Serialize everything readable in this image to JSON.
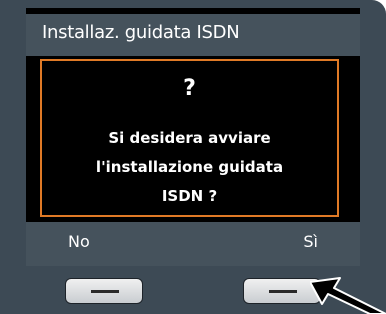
{
  "header": {
    "title": "Installaz. guidata ISDN"
  },
  "dialog": {
    "symbol": "?",
    "lines": [
      "Si desidera avviare",
      "l'installazione guidata",
      "ISDN ?"
    ]
  },
  "softkeys": {
    "left_label": "No",
    "right_label": "Sì"
  },
  "colors": {
    "accent": "#e07a26",
    "bar": "#45525c",
    "body": "#3d4a55"
  },
  "icons": {
    "key_symbol": "minus-bar",
    "pointer": "arrow-pointer-icon"
  }
}
